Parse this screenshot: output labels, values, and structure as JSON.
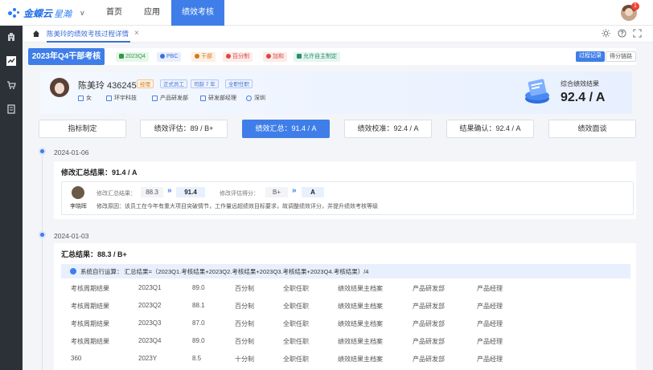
{
  "topnav": {
    "brand": "金蝶云",
    "brand_sub": "星瀚",
    "caret": "∨",
    "items": [
      "首页",
      "应用",
      "绩效考核"
    ],
    "notif_count": "1"
  },
  "tabbar": {
    "tab_label": "陈美玲的绩效考核过程详情",
    "close": "×"
  },
  "header": {
    "title": "2023年Q4干部考核",
    "tags": [
      "2023Q4",
      "PBC",
      "干部",
      "百分制",
      "加和",
      "允许自主制定"
    ],
    "btn_process": "过程记录",
    "btn_score_chain": "得分链路"
  },
  "profile": {
    "name": "陈美玲 436245",
    "tags": [
      "经理",
      "正式员工",
      "司龄 7 年",
      "全职任职"
    ],
    "gender": "女",
    "company": "环宇科技",
    "department": "产品研发部",
    "position": "研发部经理",
    "city": "深圳",
    "score_label": "综合绩效结果",
    "score_value": "92.4  / A"
  },
  "steps": [
    "指标制定",
    "绩效评估：89 / B+",
    "绩效汇总：91.4 / A",
    "绩效校准：92.4 / A",
    "结果确认：92.4 / A",
    "绩效面谈"
  ],
  "timeline": [
    {
      "date": "2024-01-06",
      "title": "修改汇总结果：91.4 / A",
      "change": {
        "operator": "李晓晖",
        "summary_label": "修改汇总结果：",
        "summary_old": "88.3",
        "summary_new": "91.4",
        "grade_label": "修改评估得分：",
        "grade_old": "B+",
        "grade_new": "A",
        "arrow": "»",
        "reason": "修改原因：该员工在今年有重大项目突破情节，工作量远超绩效目标要求，故调整绩效评分，并提升绩效考核等级"
      }
    },
    {
      "date": "2024-01-03",
      "title": "汇总结果：88.3 / B+",
      "formula": "系统自行运算：  汇总结果=（2023Q1.考核结果+2023Q2.考核结果+2023Q3.考核结果+2023Q4.考核结果）/4",
      "rows": [
        [
          "考核周期结果",
          "2023Q1",
          "89.0",
          "百分制",
          "全职任职",
          "绩效结果主档案",
          "产品研发部",
          "产品经理"
        ],
        [
          "考核周期结果",
          "2023Q2",
          "88.1",
          "百分制",
          "全职任职",
          "绩效结果主档案",
          "产品研发部",
          "产品经理"
        ],
        [
          "考核周期结果",
          "2023Q3",
          "87.0",
          "百分制",
          "全职任职",
          "绩效结果主档案",
          "产品研发部",
          "产品经理"
        ],
        [
          "考核周期结果",
          "2023Q4",
          "89.0",
          "百分制",
          "全职任职",
          "绩效结果主档案",
          "产品研发部",
          "产品经理"
        ],
        [
          "360",
          "2023Y",
          "8.5",
          "十分制",
          "全职任职",
          "绩效结果主档案",
          "产品研发部",
          "产品经理"
        ]
      ]
    }
  ],
  "colors": {
    "primary": "#3f7ee8",
    "rail": "#2c3138"
  }
}
